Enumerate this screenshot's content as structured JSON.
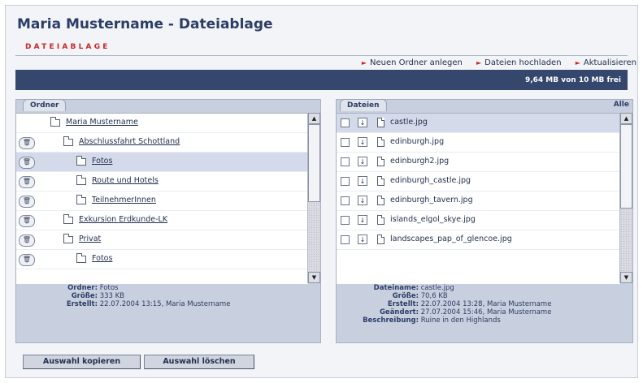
{
  "header": {
    "title": "Maria Mustername - Dateiablage",
    "subtitle": "DATEIABLAGE"
  },
  "actions": {
    "new_folder": "Neuen Ordner anlegen",
    "upload": "Dateien hochladen",
    "refresh": "Aktualisieren"
  },
  "quota": {
    "text": "9,64 MB von 10 MB frei"
  },
  "folders": {
    "tab_label": "Ordner",
    "items": [
      {
        "label": "Maria Mustername",
        "level": 0,
        "deletable": false,
        "selected": false
      },
      {
        "label": "Abschlussfahrt Schottland",
        "level": 1,
        "deletable": true,
        "selected": false
      },
      {
        "label": "Fotos",
        "level": 2,
        "deletable": true,
        "selected": true
      },
      {
        "label": "Route und Hotels",
        "level": 2,
        "deletable": true,
        "selected": false
      },
      {
        "label": "TeilnehmerInnen",
        "level": 2,
        "deletable": true,
        "selected": false
      },
      {
        "label": "Exkursion Erdkunde-LK",
        "level": 1,
        "deletable": true,
        "selected": false
      },
      {
        "label": "Privat",
        "level": 1,
        "deletable": true,
        "selected": false
      },
      {
        "label": "Fotos",
        "level": 2,
        "deletable": true,
        "selected": false
      }
    ],
    "info": {
      "ordner_label": "Ordner:",
      "ordner_value": "Fotos",
      "groesse_label": "Größe:",
      "groesse_value": "333 KB",
      "erstellt_label": "Erstellt:",
      "erstellt_value": "22.07.2004 13:15, Maria Mustername"
    }
  },
  "files": {
    "tab_label": "Dateien",
    "select_all_label": "Alle",
    "items": [
      {
        "name": "castle.jpg",
        "selected": true
      },
      {
        "name": "edinburgh.jpg",
        "selected": false
      },
      {
        "name": "edinburgh2.jpg",
        "selected": false
      },
      {
        "name": "edinburgh_castle.jpg",
        "selected": false
      },
      {
        "name": "edinburgh_tavern.jpg",
        "selected": false
      },
      {
        "name": "islands_elgol_skye.jpg",
        "selected": false
      },
      {
        "name": "landscapes_pap_of_glencoe.jpg",
        "selected": false
      }
    ],
    "info": {
      "name_label": "Dateiname:",
      "name_value": "castle.jpg",
      "groesse_label": "Größe:",
      "groesse_value": "70,6 KB",
      "erstellt_label": "Erstellt:",
      "erstellt_value": "22.07.2004 13:28, Maria Mustername",
      "geaendert_label": "Geändert:",
      "geaendert_value": "27.07.2004 15:46, Maria Mustername",
      "beschreibung_label": "Beschreibung:",
      "beschreibung_value": "Ruine in den Highlands"
    }
  },
  "buttons": {
    "copy": "Auswahl kopieren",
    "delete": "Auswahl löschen"
  },
  "icons": {
    "trash": "trash-icon",
    "folder": "folder-icon",
    "file": "file-icon",
    "download": "download-icon",
    "scroll_up": "scroll-up-arrow-icon",
    "scroll_down": "scroll-down-arrow-icon"
  },
  "colors": {
    "header_bar": "#35476d",
    "title": "#2c3e66",
    "accent_red": "#c62828",
    "selected_row": "#d4daea",
    "panel_bg": "#c8cfdf"
  }
}
